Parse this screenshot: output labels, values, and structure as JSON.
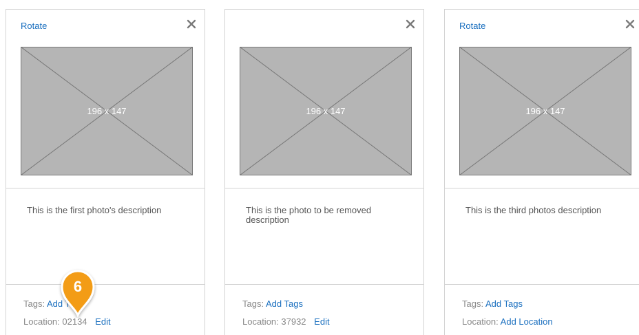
{
  "cards": [
    {
      "rotate_label": "Rotate",
      "placeholder_text": "196 x 147",
      "description": "This is the first photo's description",
      "tags_label": "Tags:",
      "tags_link": "Add Tags",
      "location_label": "Location:",
      "location_value": "02134",
      "location_link": "Edit"
    },
    {
      "rotate_label": "",
      "placeholder_text": "196 x 147",
      "description": "This is the photo to be removed description",
      "tags_label": "Tags:",
      "tags_link": "Add Tags",
      "location_label": "Location:",
      "location_value": "37932",
      "location_link": "Edit"
    },
    {
      "rotate_label": "Rotate",
      "placeholder_text": "196 x 147",
      "description": "This is the third photos description",
      "tags_label": "Tags:",
      "tags_link": "Add Tags",
      "location_label": "Location:",
      "location_value": "",
      "location_link": "Add Location"
    }
  ],
  "annotation": {
    "number": "6",
    "color": "#f39c12"
  },
  "colors": {
    "link": "#1a6fbf",
    "border": "#d3d3d3",
    "placeholder_fill": "#b5b5b5"
  }
}
